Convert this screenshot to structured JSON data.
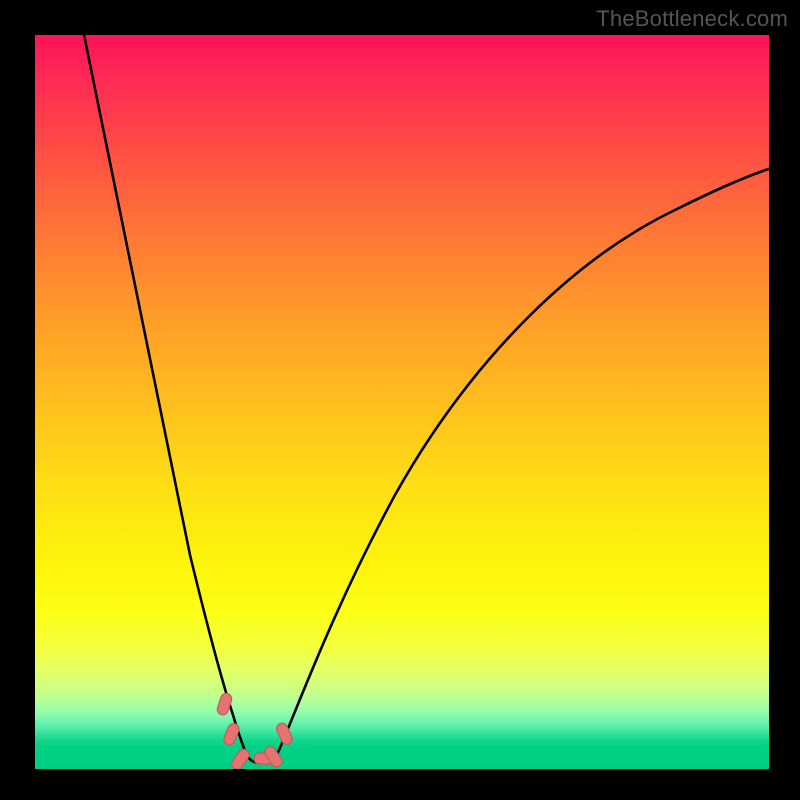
{
  "watermark": {
    "text": "TheBottleneck.com"
  },
  "colors": {
    "curve_stroke": "#000000",
    "marker_fill": "#e57373",
    "marker_stroke": "#c95a5a",
    "background": "#000000"
  },
  "chart_data": {
    "type": "line",
    "title": "",
    "xlabel": "",
    "ylabel": "",
    "xlim": [
      0,
      100
    ],
    "ylim": [
      0,
      100
    ],
    "grid": false,
    "legend": false,
    "notes": "Vertical axis reads like bottleneck % (red = high, green = low). Curve minimum (~0) occurs near x ≈ 27–32. No numeric tick labels are drawn on the image; values below are estimated from pixel positions.",
    "series": [
      {
        "name": "curve-left",
        "x": [
          11.0,
          15.0,
          19.0,
          22.0,
          24.5,
          26.0,
          27.5,
          28.5
        ],
        "y": [
          100.0,
          76.0,
          52.0,
          33.0,
          19.0,
          11.0,
          5.0,
          1.5
        ]
      },
      {
        "name": "plateau",
        "x": [
          28.5,
          30.0,
          31.5,
          33.0
        ],
        "y": [
          1.5,
          1.0,
          1.0,
          1.8
        ]
      },
      {
        "name": "curve-right",
        "x": [
          33.0,
          35.0,
          38.0,
          42.0,
          47.0,
          53.0,
          60.0,
          68.0,
          77.0,
          87.0,
          100.0
        ],
        "y": [
          1.8,
          6.0,
          13.0,
          23.0,
          34.0,
          44.0,
          53.0,
          61.0,
          68.0,
          74.0,
          80.5
        ]
      }
    ],
    "markers": [
      {
        "x": 25.8,
        "y": 8.8
      },
      {
        "x": 26.8,
        "y": 4.5
      },
      {
        "x": 28.2,
        "y": 1.8
      },
      {
        "x": 30.8,
        "y": 1.5
      },
      {
        "x": 32.6,
        "y": 2.2
      },
      {
        "x": 34.0,
        "y": 5.5
      }
    ]
  }
}
